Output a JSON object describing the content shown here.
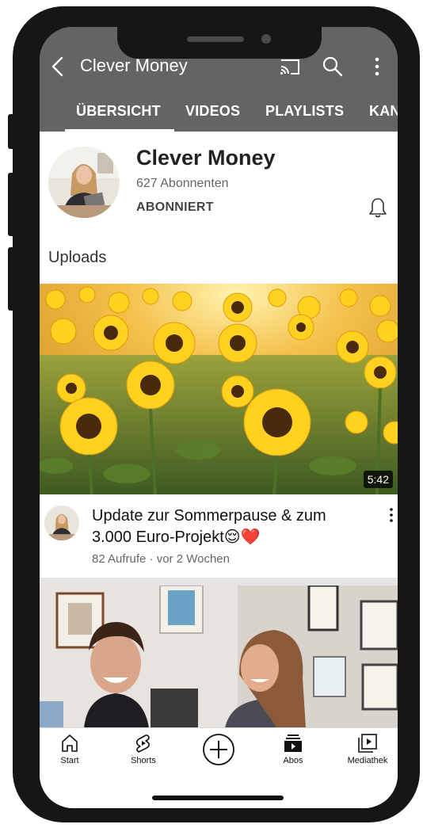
{
  "app_bar": {
    "title": "Clever Money",
    "back_icon": "arrow-back-icon",
    "cast_icon": "cast-icon",
    "search_icon": "search-icon",
    "more_icon": "more-vertical-icon",
    "background": "#646464"
  },
  "tabs": [
    {
      "label": "ÜBERSICHT",
      "active": true
    },
    {
      "label": "VIDEOS",
      "active": false
    },
    {
      "label": "PLAYLISTS",
      "active": false
    },
    {
      "label": "KAN",
      "active": false
    }
  ],
  "channel": {
    "name": "Clever Money",
    "subscribers": "627 Abonnenten",
    "subscribe_state": "ABONNIERT",
    "bell_icon": "bell-icon"
  },
  "section": {
    "title": "Uploads"
  },
  "videos": [
    {
      "title": "Update zur Sommerpause & zum 3.000 Euro-Projekt😌❤️",
      "meta": "82 Aufrufe · vor 2 Wochen",
      "duration": "5:42",
      "thumbnail": "sunflower-field"
    },
    {
      "thumbnail": "two-people-in-office"
    }
  ],
  "bottom_nav": [
    {
      "label": "Start",
      "icon": "home-icon"
    },
    {
      "label": "Shorts",
      "icon": "shorts-icon"
    },
    {
      "label": "",
      "icon": "create-plus-icon"
    },
    {
      "label": "Abos",
      "icon": "subscriptions-icon"
    },
    {
      "label": "Mediathek",
      "icon": "library-icon"
    }
  ]
}
